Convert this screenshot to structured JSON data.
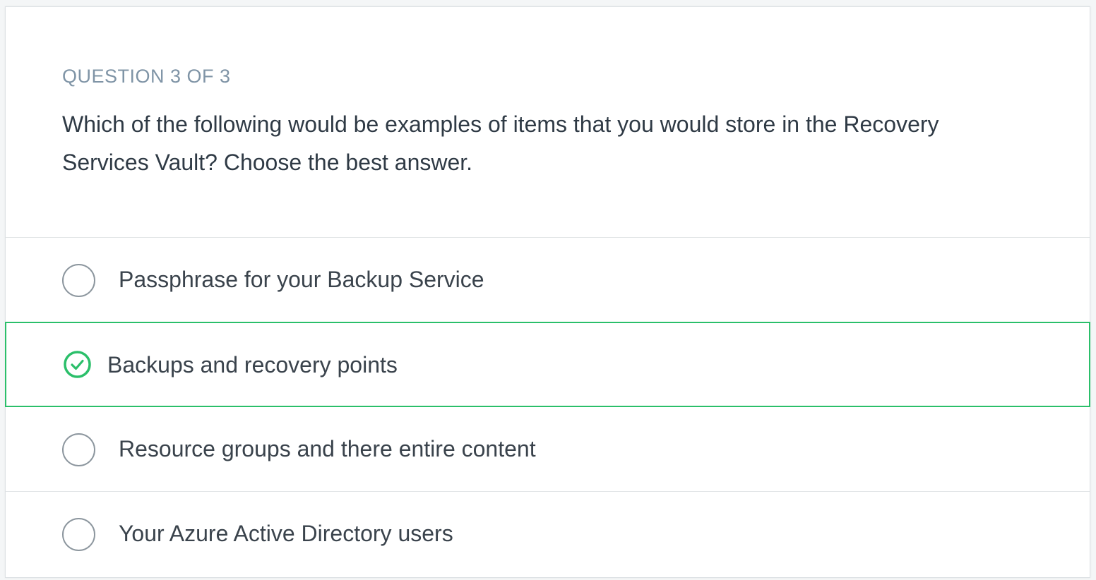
{
  "question": {
    "counter": "QUESTION 3 OF 3",
    "text": "Which of the following would be examples of items that you would store in the Recovery Services Vault? Choose the best answer."
  },
  "options": [
    {
      "label": "Passphrase for your Backup Service",
      "selected": false
    },
    {
      "label": "Backups and recovery points",
      "selected": true
    },
    {
      "label": "Resource groups and there entire content",
      "selected": false
    },
    {
      "label": "Your Azure Active Directory users",
      "selected": false
    }
  ],
  "colors": {
    "accent_selected": "#2bbf6a",
    "counter_text": "#7f94a6",
    "body_text": "#2f3a45",
    "radio_border": "#8c969e"
  },
  "icons": {
    "selected": "check-circle-icon",
    "unselected": "radio-empty-icon"
  }
}
